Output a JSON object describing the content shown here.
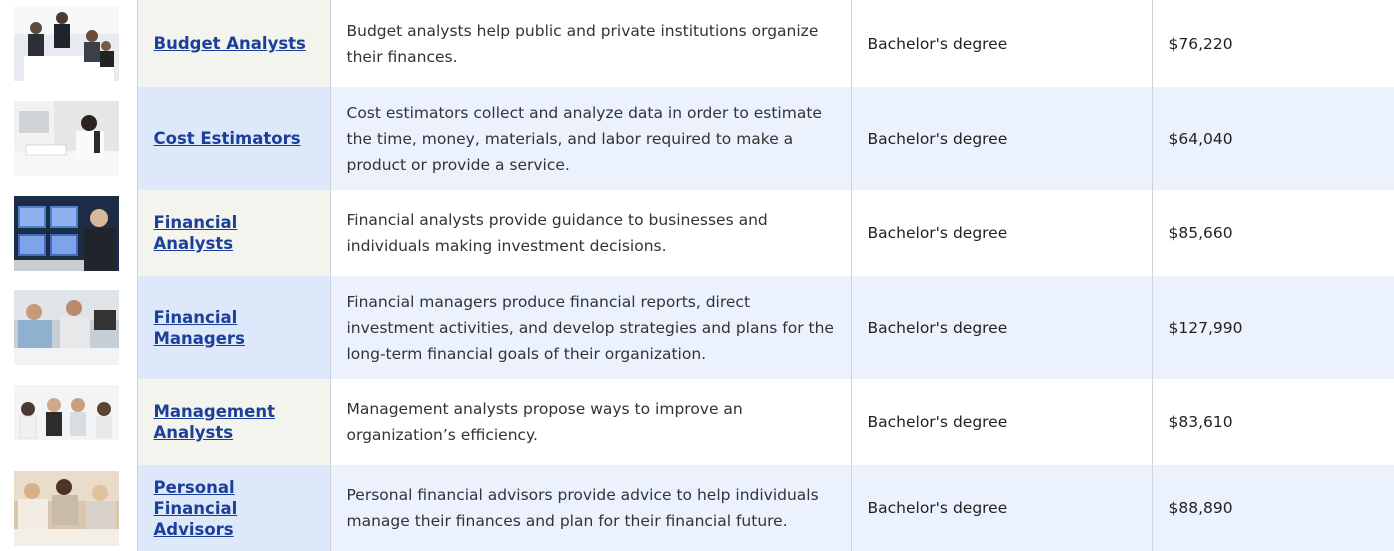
{
  "rows": [
    {
      "title": "Budget Analysts",
      "description": "Budget analysts help public and private institutions organize their finances.",
      "education": "Bachelor's degree",
      "pay": "$76,220",
      "photo_icon": "office-meeting-photo"
    },
    {
      "title": "Cost Estimators",
      "description": "Cost estimators collect and analyze data in order to estimate the time, money, materials, and labor required to make a product or provide a service.",
      "education": "Bachelor's degree",
      "pay": "$64,040",
      "photo_icon": "desk-worker-photo"
    },
    {
      "title": "Financial Analysts",
      "description": "Financial analysts provide guidance to businesses and individuals making investment decisions.",
      "education": "Bachelor's degree",
      "pay": "$85,660",
      "photo_icon": "trading-screens-photo"
    },
    {
      "title": "Financial Managers",
      "description": "Financial managers produce financial reports, direct investment activities, and develop strategies and plans for the long-term financial goals of their organization.",
      "education": "Bachelor's degree",
      "pay": "$127,990",
      "photo_icon": "manager-discussion-photo"
    },
    {
      "title": "Management Analysts",
      "description": "Management analysts propose ways to improve an organization’s efficiency.",
      "education": "Bachelor's degree",
      "pay": "$83,610",
      "photo_icon": "team-meeting-photo"
    },
    {
      "title": "Personal Financial Advisors",
      "description": "Personal financial advisors provide advice to help individuals manage their finances and plan for their financial future.",
      "education": "Bachelor's degree",
      "pay": "$88,890",
      "photo_icon": "advisor-clients-photo"
    }
  ],
  "colors": {
    "link": "#1b3f9a",
    "row_alt": "#ebf2fd",
    "title_alt": "#dde9fb",
    "title_base": "#f4f4ef"
  }
}
